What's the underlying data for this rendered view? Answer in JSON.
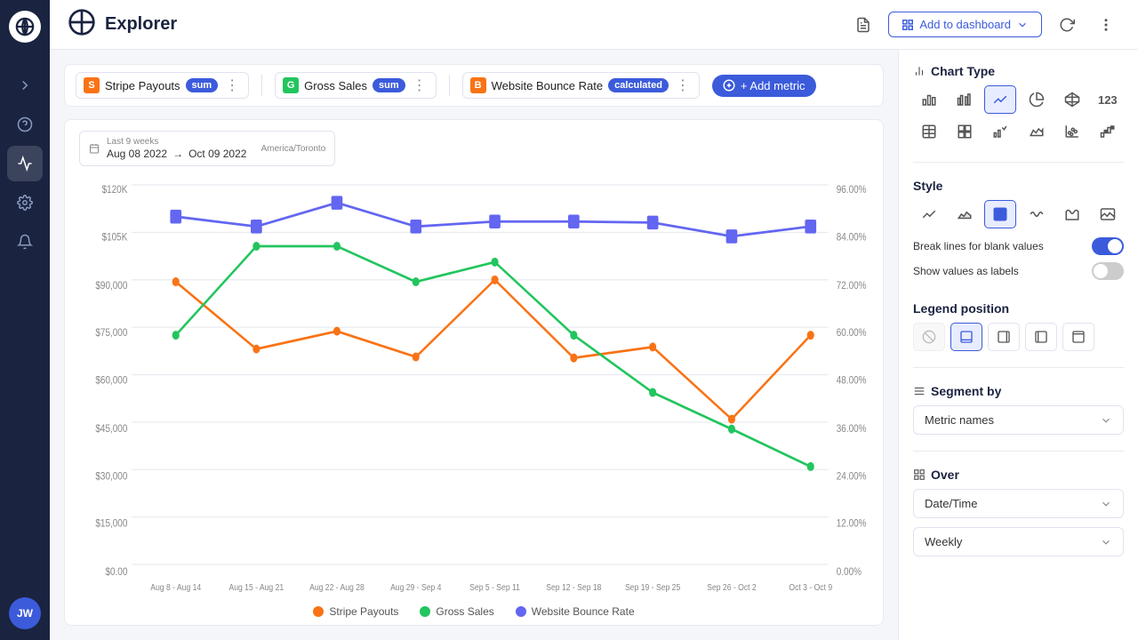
{
  "sidebar": {
    "logo_alt": "Explorer Logo",
    "nav_items": [
      {
        "id": "arrow-right",
        "label": "navigate",
        "active": false
      },
      {
        "id": "question",
        "label": "help",
        "active": false
      },
      {
        "id": "analytics",
        "label": "analytics",
        "active": true
      },
      {
        "id": "settings",
        "label": "settings",
        "active": false
      },
      {
        "id": "bell",
        "label": "notifications",
        "active": false
      }
    ],
    "avatar_initials": "JW"
  },
  "topbar": {
    "title": "Explorer",
    "add_dashboard_label": "Add to dashboard",
    "refresh_title": "Refresh",
    "more_title": "More options"
  },
  "metrics": [
    {
      "id": "stripe",
      "icon_bg": "#f97316",
      "icon_letter": "S",
      "icon_color": "#fff",
      "label": "Stripe Payouts",
      "badge": "sum",
      "badge_type": "sum"
    },
    {
      "id": "gross",
      "icon_bg": "#22c55e",
      "icon_letter": "G",
      "icon_color": "#fff",
      "label": "Gross Sales",
      "badge": "sum",
      "badge_type": "sum"
    },
    {
      "id": "bounce",
      "icon_bg": "#f97316",
      "icon_letter": "B",
      "icon_color": "#fff",
      "label": "Website Bounce Rate",
      "badge": "calculated",
      "badge_type": "calc"
    }
  ],
  "add_metric_label": "+ Add metric",
  "date_range": {
    "period_label": "Last 9 weeks",
    "timezone": "America/Toronto",
    "start": "Aug 08 2022",
    "arrow": "→",
    "end": "Oct 09 2022"
  },
  "chart": {
    "y_left_labels": [
      "$120K",
      "$105K",
      "$90,000",
      "$75,000",
      "$60,000",
      "$45,000",
      "$30,000",
      "$15,000",
      "$0.00"
    ],
    "y_right_labels": [
      "96.00%",
      "84.00%",
      "72.00%",
      "60.00%",
      "48.00%",
      "36.00%",
      "24.00%",
      "12.00%",
      "0.00%"
    ],
    "x_labels": [
      "Aug 8 - Aug 14",
      "Aug 15 - Aug 21",
      "Aug 22 - Aug 28",
      "Aug 29 - Sep 4",
      "Sep 5 - Sep 11",
      "Sep 12 - Sep 18",
      "Sep 19 - Sep 25",
      "Sep 26 - Oct 2",
      "Oct 3 - Oct 9"
    ],
    "series": [
      {
        "name": "Stripe Payouts",
        "color": "#f97316",
        "points": [
          89000,
          68000,
          75000,
          66000,
          90000,
          65000,
          69000,
          46000,
          74000
        ]
      },
      {
        "name": "Gross Sales",
        "color": "#22c55e",
        "points": [
          75000,
          100000,
          100000,
          90000,
          95000,
          75000,
          55000,
          44000,
          32000
        ]
      },
      {
        "name": "Website Bounce Rate",
        "color": "#6366f1",
        "points": [
          95000,
          92000,
          97000,
          92000,
          93000,
          93000,
          93000,
          90000,
          92000
        ]
      }
    ]
  },
  "legend": [
    {
      "label": "Stripe Payouts",
      "color": "#f97316"
    },
    {
      "label": "Gross Sales",
      "color": "#22c55e"
    },
    {
      "label": "Website Bounce Rate",
      "color": "#6366f1"
    }
  ],
  "right_panel": {
    "chart_type_title": "Chart Type",
    "chart_types": [
      {
        "id": "bar",
        "label": "Bar chart",
        "active": false
      },
      {
        "id": "grouped-bar",
        "label": "Grouped bar",
        "active": false
      },
      {
        "id": "line",
        "label": "Line chart",
        "active": true
      },
      {
        "id": "pie",
        "label": "Pie chart",
        "active": false
      },
      {
        "id": "star",
        "label": "Radar chart",
        "active": false
      },
      {
        "id": "number",
        "label": "Number",
        "active": false
      },
      {
        "id": "table",
        "label": "Table",
        "active": false
      },
      {
        "id": "pivot",
        "label": "Pivot",
        "active": false
      },
      {
        "id": "combo",
        "label": "Combo",
        "active": false
      },
      {
        "id": "area",
        "label": "Area chart",
        "active": false
      },
      {
        "id": "scatter",
        "label": "Scatter",
        "active": false
      },
      {
        "id": "waterfall",
        "label": "Waterfall",
        "active": false
      }
    ],
    "style_title": "Style",
    "style_options": [
      {
        "id": "line-style",
        "active": false
      },
      {
        "id": "area-style",
        "active": false
      },
      {
        "id": "image-style",
        "active": true
      },
      {
        "id": "wave-style",
        "active": false
      },
      {
        "id": "bar-style",
        "active": false
      },
      {
        "id": "filled-style",
        "active": false
      }
    ],
    "break_lines_label": "Break lines for blank values",
    "break_lines_on": true,
    "show_values_label": "Show values as labels",
    "show_values_on": false,
    "legend_position_title": "Legend position",
    "legend_positions": [
      {
        "id": "none",
        "active": false,
        "disabled": true
      },
      {
        "id": "bottom",
        "active": true
      },
      {
        "id": "right",
        "active": false
      },
      {
        "id": "left",
        "active": false
      },
      {
        "id": "top",
        "active": false
      }
    ],
    "segment_by_title": "Segment by",
    "segment_placeholder": "Metric names",
    "over_title": "Over",
    "over_value": "Date/Time",
    "frequency_value": "Weekly"
  }
}
